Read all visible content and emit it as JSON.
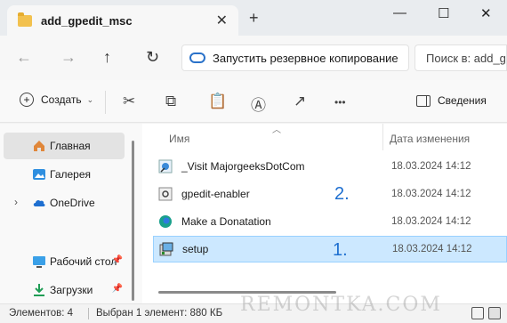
{
  "window": {
    "tab_title": "add_gpedit_msc",
    "tab_close": "✕",
    "new_tab": "+",
    "minimize": "—",
    "maximize": "☐",
    "close": "✕"
  },
  "nav": {
    "back": "←",
    "forward": "→",
    "up": "↑",
    "refresh": "↻",
    "address_text": "Запустить резервное копирование",
    "search_placeholder": "Поиск в: add_gpedit_msc"
  },
  "toolbar": {
    "create_label": "Создать",
    "create_chevron": "⌄",
    "more": "•••",
    "details_label": "Сведения"
  },
  "sidebar": {
    "items": [
      {
        "label": "Главная",
        "icon": "home-icon",
        "active": true
      },
      {
        "label": "Галерея",
        "icon": "gallery-icon"
      },
      {
        "label": "OneDrive",
        "icon": "cloud-icon",
        "expander": "›"
      },
      {
        "label": "Рабочий стол",
        "icon": "desktop-icon",
        "pin": "📌"
      },
      {
        "label": "Загрузки",
        "icon": "downloads-icon",
        "pin": "📌"
      }
    ]
  },
  "columns": {
    "name": "Имя",
    "date": "Дата изменения"
  },
  "files": [
    {
      "name": "_Visit MajorgeeksDotCom",
      "date": "18.03.2024 14:12",
      "icon": "internet-shortcut-icon"
    },
    {
      "name": "gpedit-enabler",
      "date": "18.03.2024 14:12",
      "icon": "script-file-icon"
    },
    {
      "name": "Make a Donatation",
      "date": "18.03.2024 14:12",
      "icon": "edge-shortcut-icon"
    },
    {
      "name": "setup",
      "date": "18.03.2024 14:12",
      "icon": "setup-icon",
      "selected": true
    }
  ],
  "markers": {
    "m1": "1.",
    "m2": "2."
  },
  "status": {
    "count": "Элементов: 4",
    "selected": "Выбран 1 элемент: 880 КБ"
  },
  "watermark": "REMONTKA.COM",
  "colors": {
    "accent": "#1e6fd0",
    "selection_bg": "#cce8ff",
    "selection_border": "#99d1ff"
  }
}
